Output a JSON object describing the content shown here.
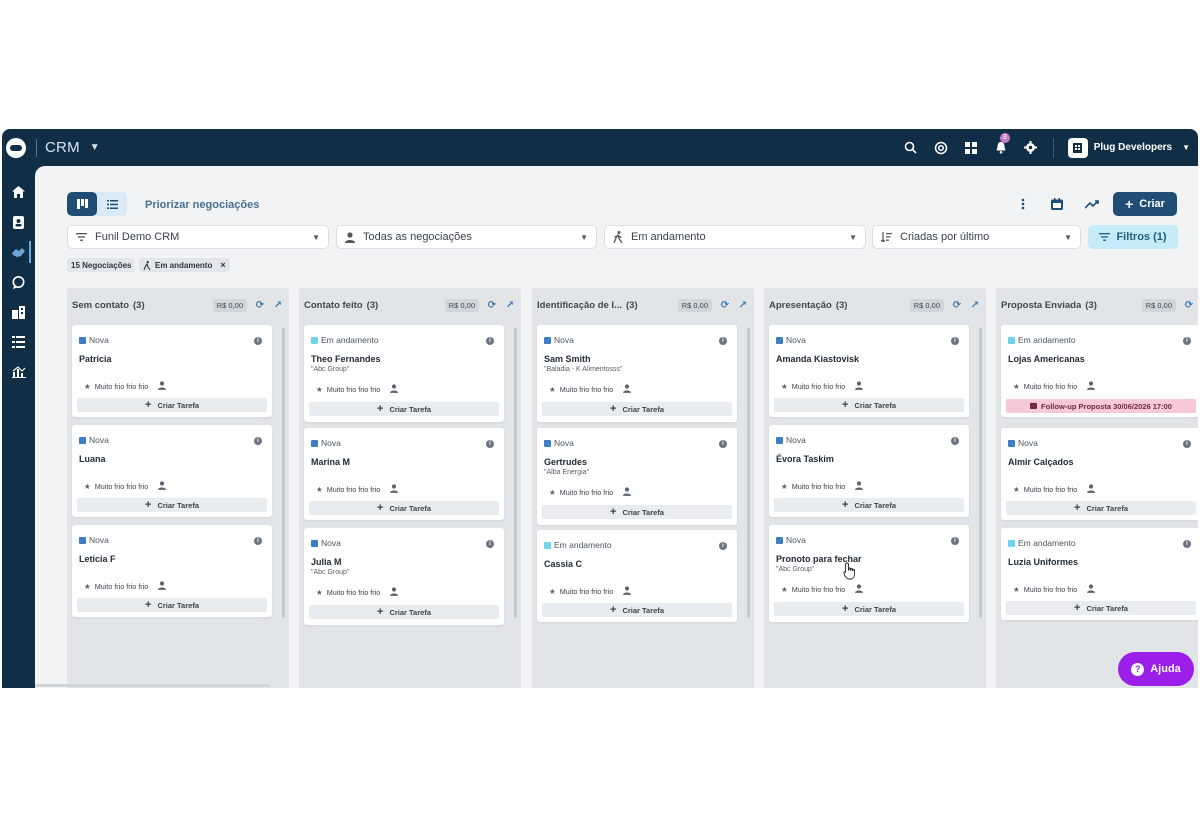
{
  "topbar": {
    "app_name": "CRM",
    "notification_count": "3",
    "org_name": "Plug Developers"
  },
  "sidebar": {
    "items": [
      "home-icon",
      "contacts-icon",
      "deals-icon",
      "chat-icon",
      "companies-icon",
      "tasks-icon",
      "reports-icon"
    ],
    "active": "deals-icon"
  },
  "toolbar": {
    "prioritize_label": "Priorizar negociações",
    "create_label": "Criar",
    "filters_label": "Filtros (1)",
    "funnel": "Funil Demo CRM",
    "deals_filter": "Todas as negociações",
    "status_filter": "Em andamento",
    "sort_filter": "Criadas por último"
  },
  "chips": {
    "count": "15 Negociações",
    "status": "Em andamento"
  },
  "columns": [
    {
      "title": "Sem contato",
      "count": "(3)",
      "value": "R$ 0,00",
      "cards": [
        {
          "status": "Nova",
          "name": "Patricia",
          "company": "",
          "temperature": "Muito frio frio frio",
          "task": "Criar Tarefa"
        },
        {
          "status": "Nova",
          "name": "Luana",
          "company": "",
          "temperature": "Muito frio frio frio",
          "task": "Criar Tarefa"
        },
        {
          "status": "Nova",
          "name": "Leticia F",
          "company": "",
          "temperature": "Muito frio frio frio",
          "task": "Criar Tarefa"
        }
      ]
    },
    {
      "title": "Contato feito",
      "count": "(3)",
      "value": "R$ 0,00",
      "cards": [
        {
          "status": "Em andamento",
          "name": "Theo Fernandes",
          "company": "\"Abc Group\"",
          "temperature": "Muito frio frio frio",
          "task": "Criar Tarefa"
        },
        {
          "status": "Nova",
          "name": "Marina M",
          "company": "",
          "temperature": "Muito frio frio frio",
          "task": "Criar Tarefa"
        },
        {
          "status": "Nova",
          "name": "Julia M",
          "company": "\"Abc Group\"",
          "temperature": "Muito frio frio frio",
          "task": "Criar Tarefa"
        }
      ]
    },
    {
      "title": "Identificação de I...",
      "count": "(3)",
      "value": "R$ 0,00",
      "cards": [
        {
          "status": "Nova",
          "name": "Sam Smith",
          "company": "\"Baladia - K Alimentosss\"",
          "temperature": "Muito frio frio frio",
          "task": "Criar Tarefa"
        },
        {
          "status": "Nova",
          "name": "Gertrudes",
          "company": "\"Alba Energia\"",
          "temperature": "Muito frio frio frio",
          "task": "Criar Tarefa"
        },
        {
          "status": "Em andamento",
          "name": "Cassia C",
          "company": "",
          "temperature": "Muito frio frio frio",
          "task": "Criar Tarefa"
        }
      ]
    },
    {
      "title": "Apresentação",
      "count": "(3)",
      "value": "R$ 0,00",
      "cards": [
        {
          "status": "Nova",
          "name": "Amanda Kiastovisk",
          "company": "",
          "temperature": "Muito frio frio frio",
          "task": "Criar Tarefa"
        },
        {
          "status": "Nova",
          "name": "Évora Taskim",
          "company": "",
          "temperature": "Muito frio frio frio",
          "task": "Criar Tarefa"
        },
        {
          "status": "Nova",
          "name": "Pronoto para fechar",
          "company": "\"Abc Group\"",
          "temperature": "Muito frio frio frio",
          "task": "Criar Tarefa"
        }
      ]
    },
    {
      "title": "Proposta Enviada",
      "count": "(3)",
      "value": "R$ 0,00",
      "cards": [
        {
          "status": "Em andamento",
          "name": "Lojas Americanas",
          "company": "",
          "temperature": "Muito frio frio frio",
          "task": "",
          "followup": "Follow-up Proposta 30/06/2026 17:00"
        },
        {
          "status": "Nova",
          "name": "Almir Calçados",
          "company": "",
          "temperature": "Muito frio frio frio",
          "task": "Criar Tarefa"
        },
        {
          "status": "Em andamento",
          "name": "Luzia Uniformes",
          "company": "",
          "temperature": "Muito frio frio frio",
          "task": "Criar Tarefa"
        }
      ]
    }
  ],
  "help_label": "Ajuda",
  "colors": {
    "nova": "#3d7dc4",
    "em_andamento": "#6fd6ea",
    "primary": "#1f4d73",
    "help": "#9b1fe8"
  }
}
